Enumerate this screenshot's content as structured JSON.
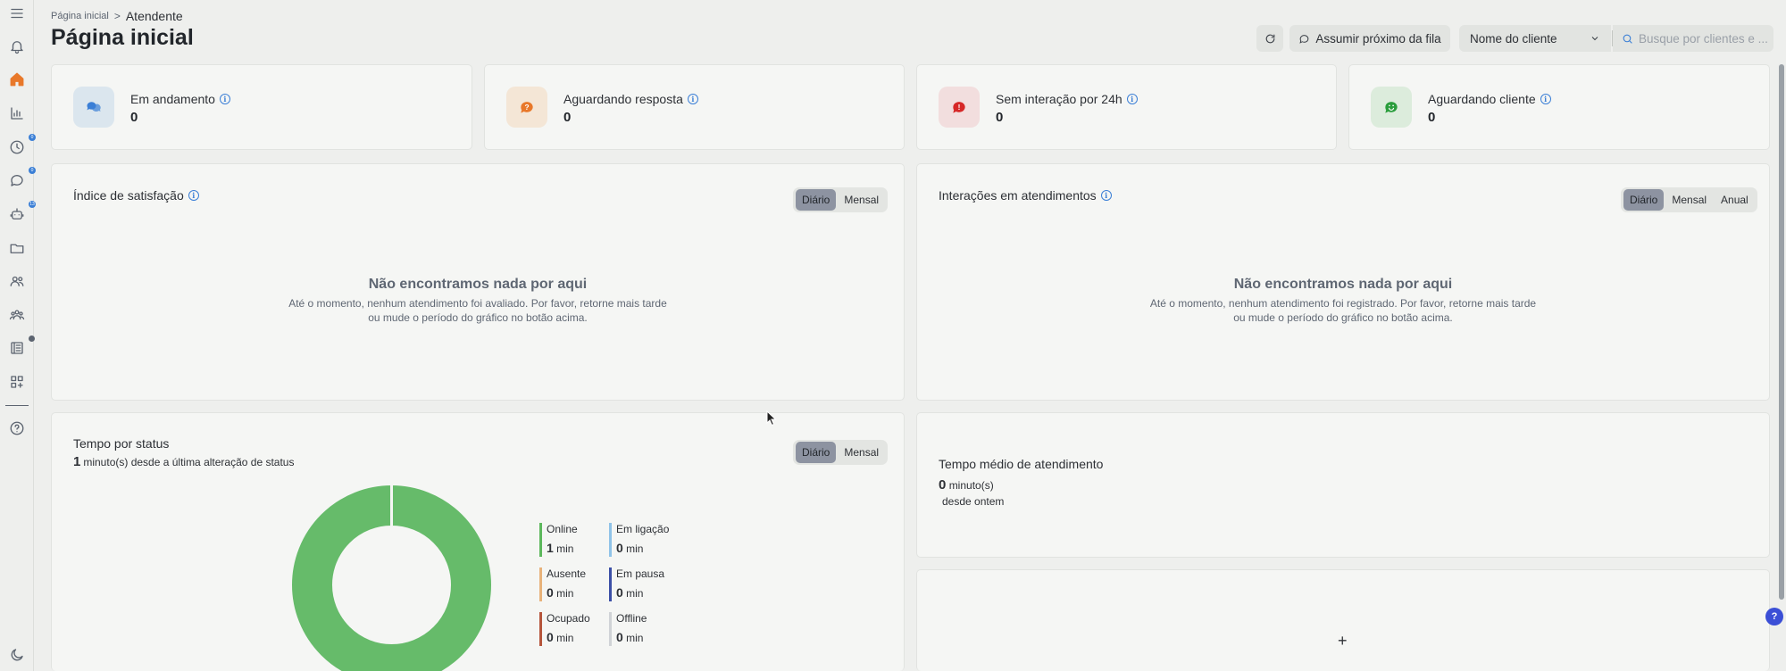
{
  "breadcrumb": {
    "home": "Página inicial",
    "separator": ">",
    "current": "Atendente"
  },
  "page_title": "Página inicial",
  "toolbar": {
    "assume_label": "Assumir próximo da fila",
    "client_select": "Nome do cliente",
    "search_placeholder": "Busque por clientes e ..."
  },
  "sidebar": {
    "badges": [
      "0",
      "0",
      "13"
    ]
  },
  "kpis": [
    {
      "label": "Em andamento",
      "value": "0",
      "icon": "chat-bubbles-icon",
      "color": "#3b7fd6",
      "bg": "#dbe6ee"
    },
    {
      "label": "Aguardando resposta",
      "value": "0",
      "icon": "question-bubble-icon",
      "color": "#e8782a",
      "bg": "#f4e6d6"
    },
    {
      "label": "Sem interação por 24h",
      "value": "0",
      "icon": "alert-bubble-icon",
      "color": "#d62828",
      "bg": "#f2dede"
    },
    {
      "label": "Aguardando cliente",
      "value": "0",
      "icon": "smile-bubble-icon",
      "color": "#2a9d3c",
      "bg": "#dcecdc"
    }
  ],
  "satisfaction": {
    "title": "Índice de satisfação",
    "toggle": [
      "Diário",
      "Mensal"
    ],
    "empty_title": "Não encontramos nada por aqui",
    "empty_desc": "Até o momento, nenhum atendimento foi avaliado. Por favor, retorne mais tarde ou mude o período do gráfico no botão acima."
  },
  "interactions": {
    "title": "Interações em atendimentos",
    "toggle": [
      "Diário",
      "Mensal",
      "Anual"
    ],
    "empty_title": "Não encontramos nada por aqui",
    "empty_desc": "Até o momento, nenhum atendimento foi registrado. Por favor, retorne mais tarde ou mude o período do gráfico no botão acima."
  },
  "status_time": {
    "title": "Tempo por status",
    "since_value": "1",
    "since_text": "minuto(s) desde a última alteração de status",
    "toggle": [
      "Diário",
      "Mensal"
    ],
    "legend": [
      {
        "name": "Online",
        "value": "1",
        "unit": "min",
        "color": "#5cb85c"
      },
      {
        "name": "Em ligação",
        "value": "0",
        "unit": "min",
        "color": "#8fc3e8"
      },
      {
        "name": "Ausente",
        "value": "0",
        "unit": "min",
        "color": "#e8b27a"
      },
      {
        "name": "Em pausa",
        "value": "0",
        "unit": "min",
        "color": "#3b4fa6"
      },
      {
        "name": "Ocupado",
        "value": "0",
        "unit": "min",
        "color": "#b5543a"
      },
      {
        "name": "Offline",
        "value": "0",
        "unit": "min",
        "color": "#d0d3d6"
      }
    ],
    "donut_color": "#66bb6a"
  },
  "avg_time": {
    "title": "Tempo médio de atendimento",
    "value": "0",
    "unit": "minuto(s)",
    "since": "desde ontem"
  },
  "add_widget": "+",
  "help": "?"
}
